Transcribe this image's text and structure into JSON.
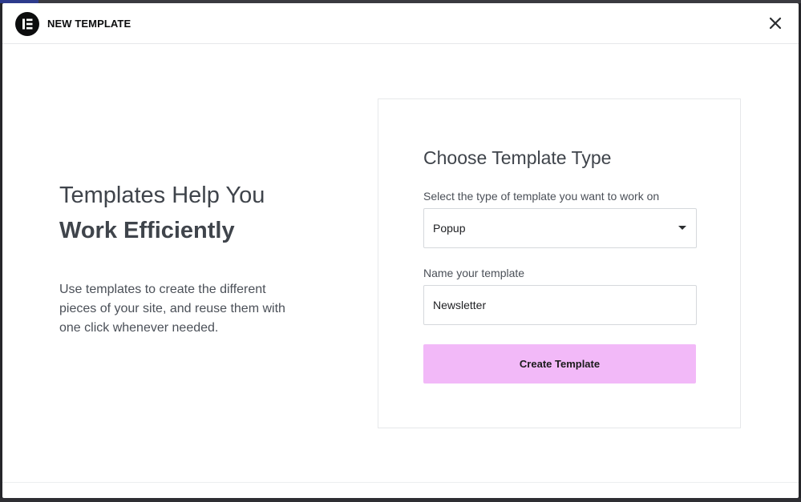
{
  "header": {
    "title": "NEW TEMPLATE"
  },
  "intro": {
    "title_line1": "Templates Help You",
    "title_line2": "Work Efficiently",
    "description": "Use templates to create the different pieces of your site, and reuse them with one click whenever needed."
  },
  "form": {
    "title": "Choose Template Type",
    "type_label": "Select the type of template you want to work on",
    "type_value": "Popup",
    "name_label": "Name your template",
    "name_value": "Newsletter",
    "submit_label": "Create Template"
  },
  "colors": {
    "accent_button": "#f2b9f8",
    "logo_bg": "#0c0d0e"
  },
  "icons": {
    "logo": "elementor-logo-icon",
    "close": "close-icon",
    "caret": "caret-down-icon"
  }
}
